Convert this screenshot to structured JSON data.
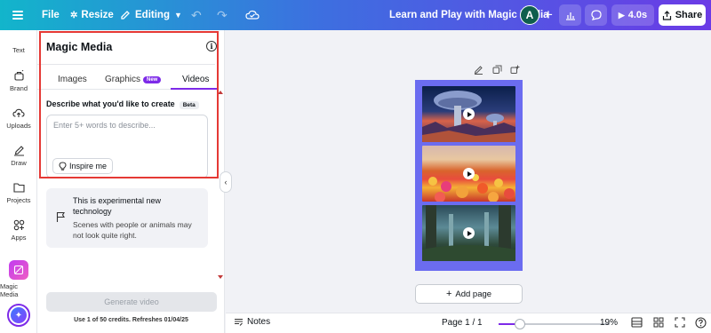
{
  "topbar": {
    "file_label": "File",
    "resize_label": "Resize",
    "editing_label": "Editing",
    "doc_title": "Learn and Play with Magic Media",
    "avatar_initial": "A",
    "present_label": "4.0s",
    "share_label": "Share"
  },
  "rail": {
    "items": [
      {
        "label": "Text",
        "icon": "text-icon"
      },
      {
        "label": "Brand",
        "icon": "brand-icon"
      },
      {
        "label": "Uploads",
        "icon": "upload-icon"
      },
      {
        "label": "Draw",
        "icon": "draw-icon"
      },
      {
        "label": "Projects",
        "icon": "folder-icon"
      },
      {
        "label": "Apps",
        "icon": "apps-icon"
      },
      {
        "label": "Magic Media",
        "icon": "magic-media-icon"
      }
    ]
  },
  "panel": {
    "title": "Magic Media",
    "tabs": [
      {
        "label": "Images"
      },
      {
        "label": "Graphics",
        "badge": "New"
      },
      {
        "label": "Videos",
        "active": true
      }
    ],
    "describe_label": "Describe what you'd like to create",
    "beta_label": "Beta",
    "prompt_value": "",
    "prompt_placeholder": "Enter 5+ words to describe...",
    "inspire_label": "Inspire me",
    "experimental": {
      "title": "This is experimental new technology",
      "body": "Scenes with people or animals may not look quite right."
    },
    "generate_label": "Generate video",
    "credits_text": "Use 1 of 50 credits. Refreshes 01/04/25"
  },
  "canvas": {
    "add_page_label": "Add page",
    "page_color": "#6b6cf0"
  },
  "bottombar": {
    "notes_label": "Notes",
    "page_indicator": "Page 1 / 1",
    "zoom_label": "19%",
    "zoom_fraction": 0.19
  },
  "colors": {
    "accent": "#7d2ae8",
    "highlight": "#e53935"
  }
}
